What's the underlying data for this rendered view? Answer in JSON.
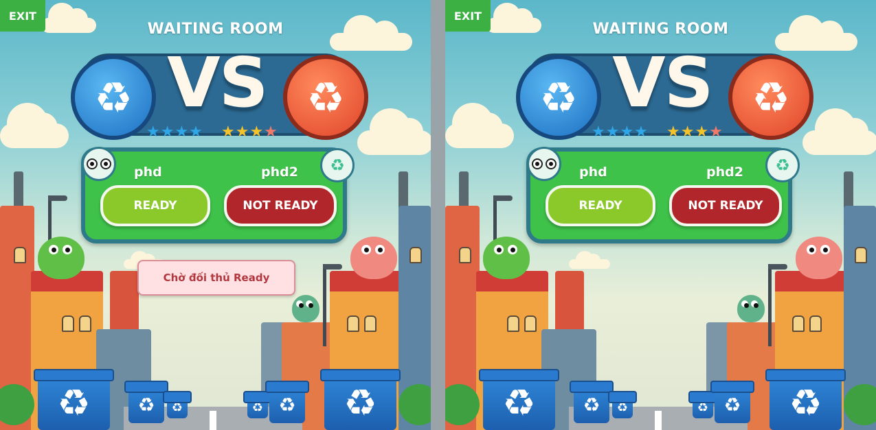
{
  "panels": [
    {
      "exit_label": "EXIT",
      "title": "WAITING ROOM",
      "vs_text": "VS",
      "recycle_symbol": "♻",
      "left_stars": "★★★★",
      "right_stars": "★★★",
      "right_last_star": "★",
      "player1": {
        "name": "phd",
        "status_label": "READY"
      },
      "player2": {
        "name": "phd2",
        "status_label": "NOT READY"
      },
      "wait_message": "Chờ đối thủ Ready"
    },
    {
      "exit_label": "EXIT",
      "title": "WAITING ROOM",
      "vs_text": "VS",
      "recycle_symbol": "♻",
      "left_stars": "★★★★",
      "right_stars": "★★★",
      "right_last_star": "★",
      "player1": {
        "name": "phd",
        "status_label": "READY"
      },
      "player2": {
        "name": "phd2",
        "status_label": "NOT READY"
      }
    }
  ],
  "icons": {
    "player1_avatar": "creature-face-icon",
    "player2_avatar": "recycle-refresh-icon",
    "team_badge_left": "recycle-icon",
    "team_badge_right": "recycle-icon"
  },
  "colors": {
    "exit_button": "#3cb043",
    "ready_button": "#8bc92a",
    "not_ready_button": "#b0262a",
    "player_card": "#3fc24a",
    "wait_message_bg": "#ffe0e3",
    "wait_message_text": "#b2383f",
    "badge_blue": "#1d6fc2",
    "badge_red": "#e0452a"
  }
}
